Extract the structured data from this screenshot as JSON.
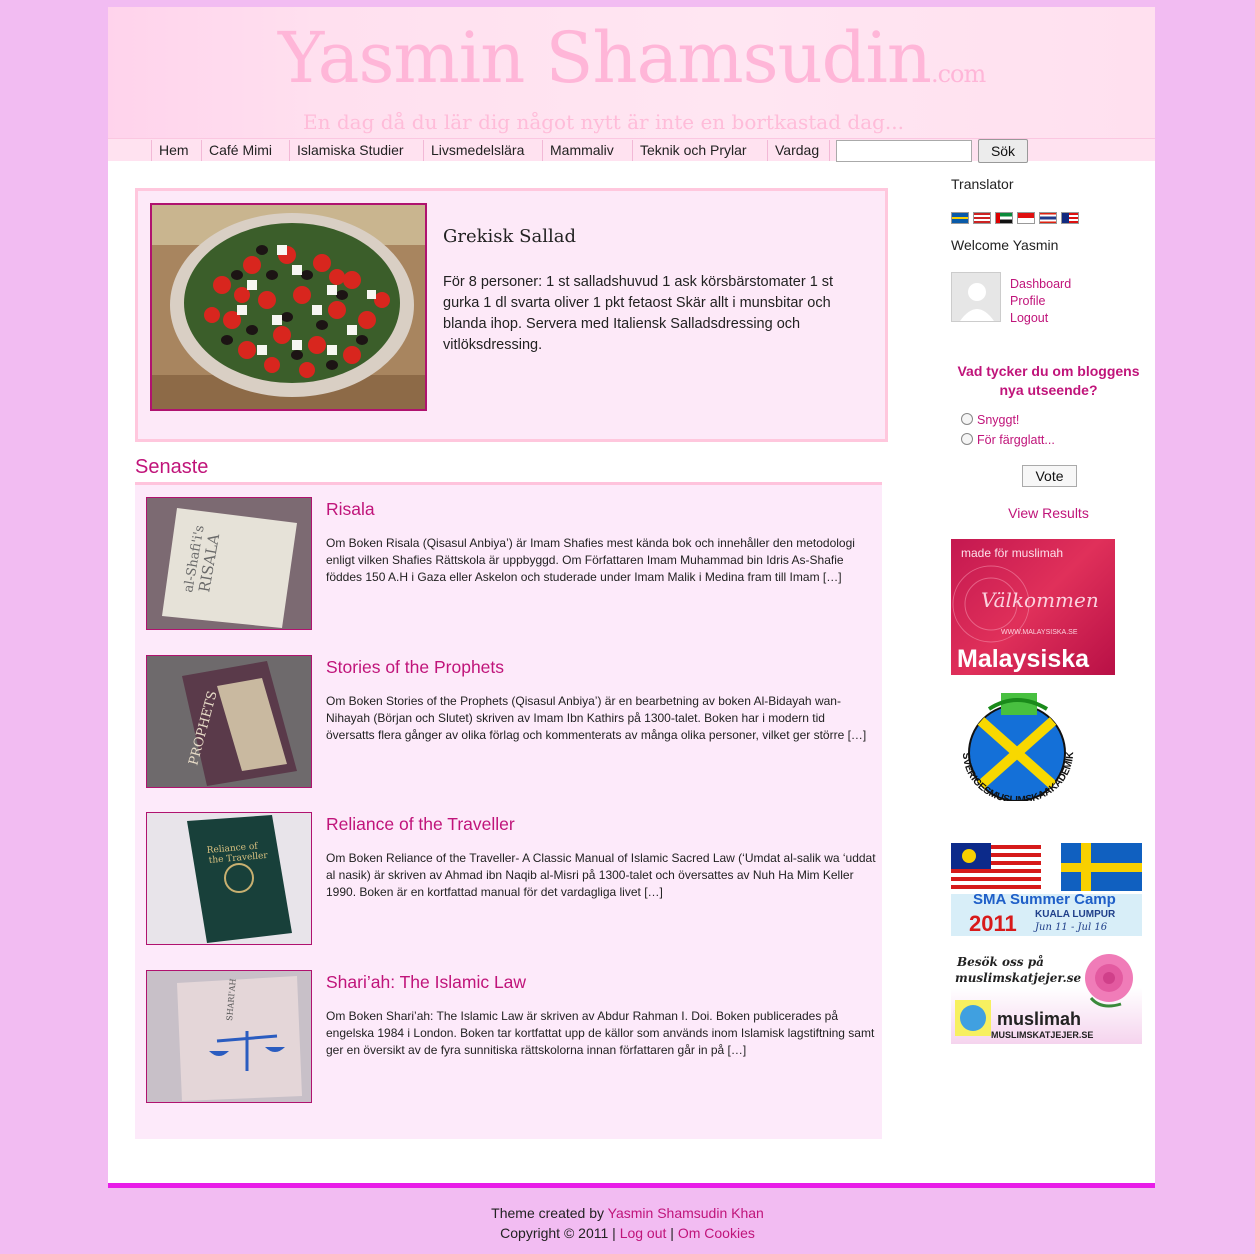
{
  "header": {
    "site_title": "Yasmin Shamsudin",
    "site_title_suffix": ".com",
    "tagline": "En dag då du lär dig något nytt är inte en bortkastad dag..."
  },
  "nav": {
    "items": [
      "Hem",
      "Café Mimi",
      "Islamiska Studier",
      "Livsmedelslära",
      "Mammaliv",
      "Teknik och Prylar",
      "Vardag"
    ],
    "search_value": "",
    "search_button": "Sök"
  },
  "featured": {
    "title": "Grekisk Sallad",
    "text": "För 8 personer: 1 st salladshuvud 1 ask körsbärstomater 1 st gurka 1 dl svarta oliver 1 pkt fetaost Skär allt i munsbitar och blanda ihop. Servera med Italiensk Salladsdressing och vitlöksdressing."
  },
  "latest": {
    "heading": "Senaste",
    "posts": [
      {
        "title": "Risala",
        "excerpt": "Om Boken Risala (Qisasul Anbiya’) är Imam Shafies mest kända bok och innehåller den metodologi enligt vilken Shafies Rättskola är uppbyggd. Om Författaren Imam Muhammad bin Idris As-Shafie föddes 150 A.H i Gaza eller Askelon och studerade under Imam Malik i Medina fram till Imam […]"
      },
      {
        "title": "Stories of the Prophets",
        "excerpt": "Om Boken Stories of the Prophets (Qisasul Anbiya’) är en bearbetning av boken Al-Bidayah wan-Nihayah (Början och Slutet) skriven av Imam Ibn Kathirs på 1300-talet. Boken har i modern tid översatts flera gånger av olika förlag och kommenterats av många olika personer, vilket ger större […]"
      },
      {
        "title": "Reliance of the Traveller",
        "excerpt": "Om Boken Reliance of the Traveller- A Classic Manual of Islamic Sacred Law (‘Umdat al-salik wa ‘uddat al nasik) är skriven av Ahmad ibn Naqib al-Misri på 1300-talet och översattes av Nuh Ha Mim Keller 1990. Boken är en kortfattad manual för det vardagliga livet […]"
      },
      {
        "title": "Shari’ah: The Islamic Law",
        "excerpt": "Om Boken Shari’ah: The Islamic Law är skriven av Abdur Rahman I. Doi. Boken publicerades på engelska 1984 i London. Boken tar kortfattat upp de källor som används inom Islamisk lagstiftning samt ger en översikt av de fyra sunnitiska rättskolorna innan författaren går in på […]"
      }
    ]
  },
  "sidebar": {
    "translator_heading": "Translator",
    "flags": [
      "swedish-flag-icon",
      "us-flag-icon",
      "uae-flag-icon",
      "indonesia-flag-icon",
      "thailand-flag-icon",
      "malaysia-flag-icon"
    ],
    "welcome": "Welcome Yasmin",
    "user_links": [
      "Dashboard",
      "Profile",
      "Logout"
    ],
    "poll": {
      "question": "Vad tycker du om bloggens nya utseende?",
      "options": [
        "Snyggt!",
        "För färgglatt..."
      ],
      "vote_button": "Vote",
      "view_results": "View Results"
    },
    "banners": {
      "malaysiska": {
        "line1": "made för muslimah",
        "line2": "Välkommen",
        "url": "WWW.MALAYSISKA.SE",
        "name": "Malaysiska"
      },
      "sma": {
        "text": "SVERIGESMUSLIMSKAAKADEMIKER"
      },
      "summer_camp": {
        "title": "SMA Summer Camp",
        "year": "2011",
        "place": "KUALA LUMPUR",
        "dates": "Jun 11 - Jul 16"
      },
      "muslimskatjejer": {
        "line1": "Besök oss på",
        "line2": "muslimskatjejer.se",
        "logo": "muslimah",
        "url": "MUSLIMSKATJEJER.SE"
      }
    }
  },
  "footer": {
    "theme_prefix": "Theme created by",
    "theme_author": "Yasmin Shamsudin Khan",
    "copyright": "Copyright © 2011",
    "sep": "|",
    "logout": "Log out",
    "cookies": "Om Cookies"
  },
  "colors": {
    "background": "#f2bcf2",
    "accent": "#c0147a",
    "footer_rule": "#e81ce8"
  }
}
